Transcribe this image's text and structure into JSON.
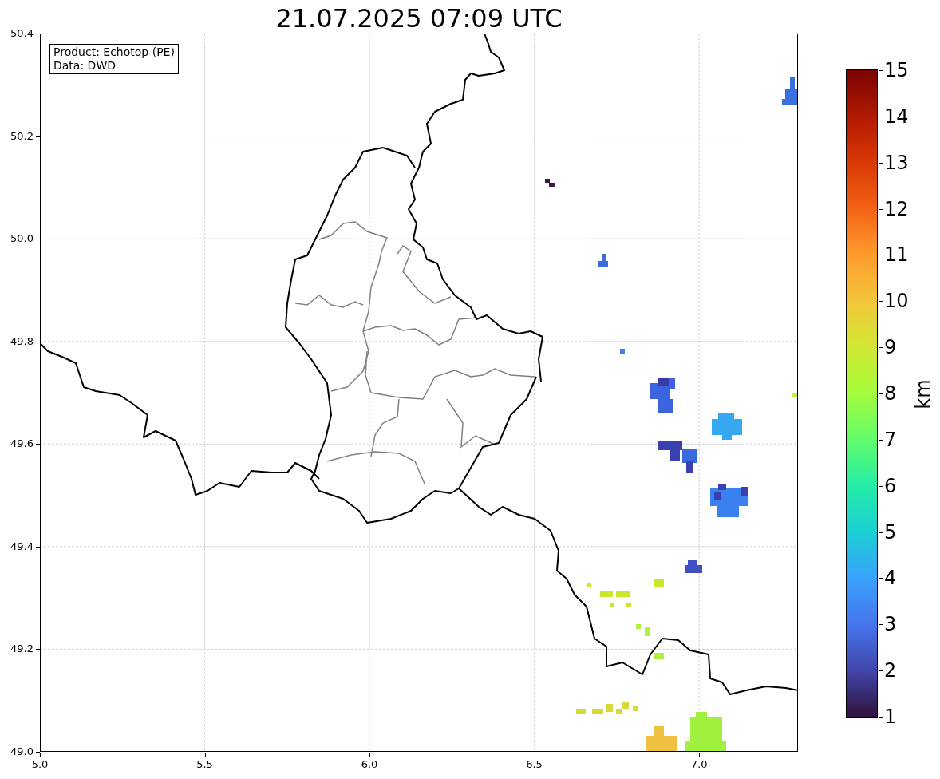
{
  "title": "21.07.2025 07:09 UTC",
  "legend": [
    "Product: Echotop (PE)",
    "Data: DWD"
  ],
  "x_ticks": [
    "5.0",
    "5.5",
    "6.0",
    "6.5",
    "7.0"
  ],
  "y_ticks": [
    "50.4",
    "50.2",
    "50.0",
    "49.8",
    "49.6",
    "49.4",
    "49.2",
    "49.0"
  ],
  "colorbar": {
    "label": "km",
    "ticks": [
      "15",
      "14",
      "13",
      "12",
      "11",
      "10",
      "9",
      "8",
      "7",
      "6",
      "5",
      "4",
      "3",
      "2",
      "1"
    ]
  }
}
